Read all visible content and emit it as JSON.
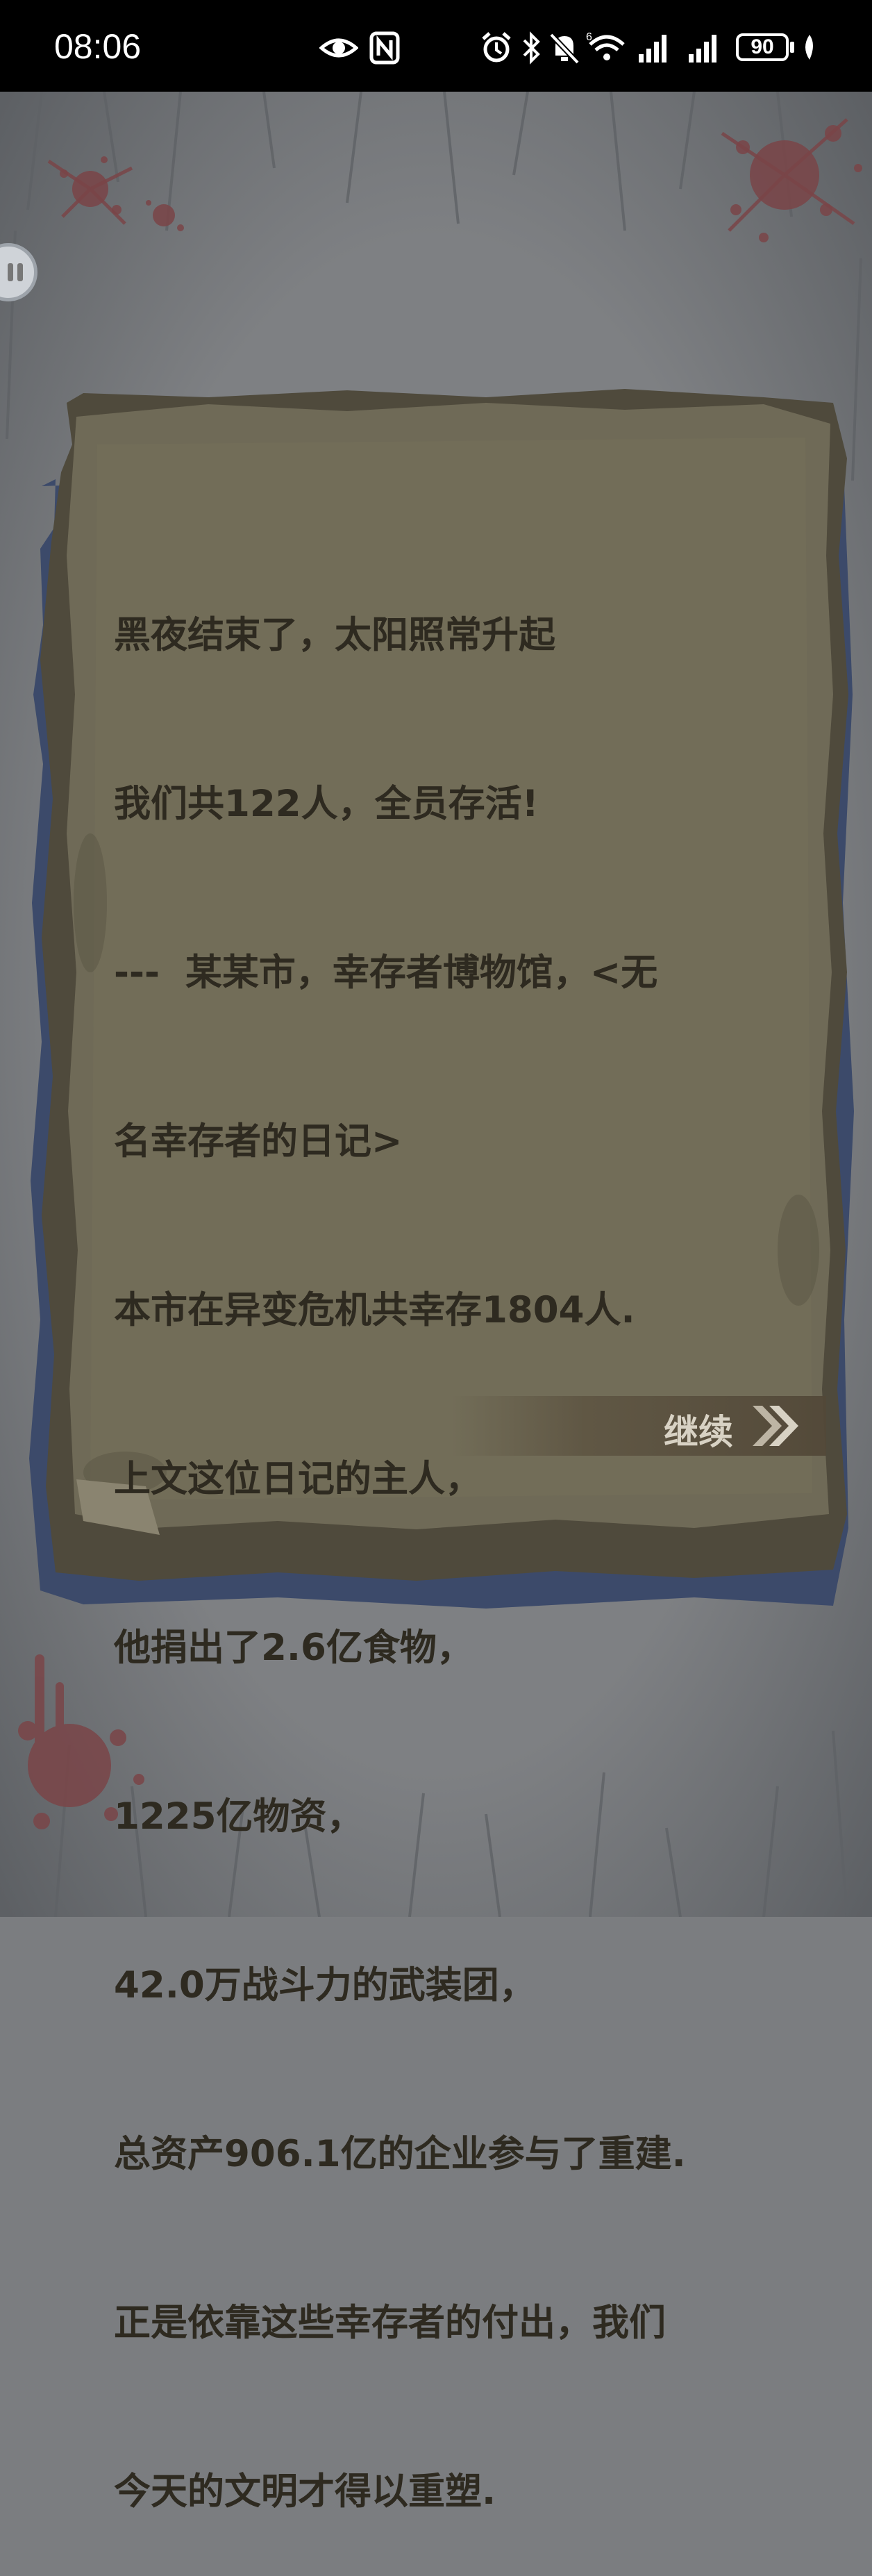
{
  "status_bar": {
    "time": "08:06",
    "battery_level": "90",
    "icons": [
      "eye-icon",
      "nfc-icon",
      "alarm-icon",
      "bluetooth-icon",
      "mute-icon",
      "wifi-6-icon",
      "signal-icon",
      "signal-icon",
      "battery-icon",
      "leaf-icon"
    ]
  },
  "diary": {
    "lines": [
      "黑夜结束了，太阳照常升起",
      "我们共122人，全员存活!",
      "---  某某市，幸存者博物馆，<无",
      "名幸存者的日记>",
      "本市在异变危机共幸存1804人.",
      "上文这位日记的主人，",
      "他捐出了2.6亿食物，",
      "1225亿物资，",
      "42.0万战斗力的武装团，",
      "总资产906.1亿的企业参与了重建.",
      "正是依靠这些幸存者的付出，我们",
      "今天的文明才得以重塑."
    ]
  },
  "continue_button": {
    "label": "继续"
  },
  "colors": {
    "background": "#7b7d80",
    "paper": "#6f6a57",
    "paper_edge": "#4f4a3c",
    "text": "#2e2a20",
    "blood": "#7a4548"
  }
}
